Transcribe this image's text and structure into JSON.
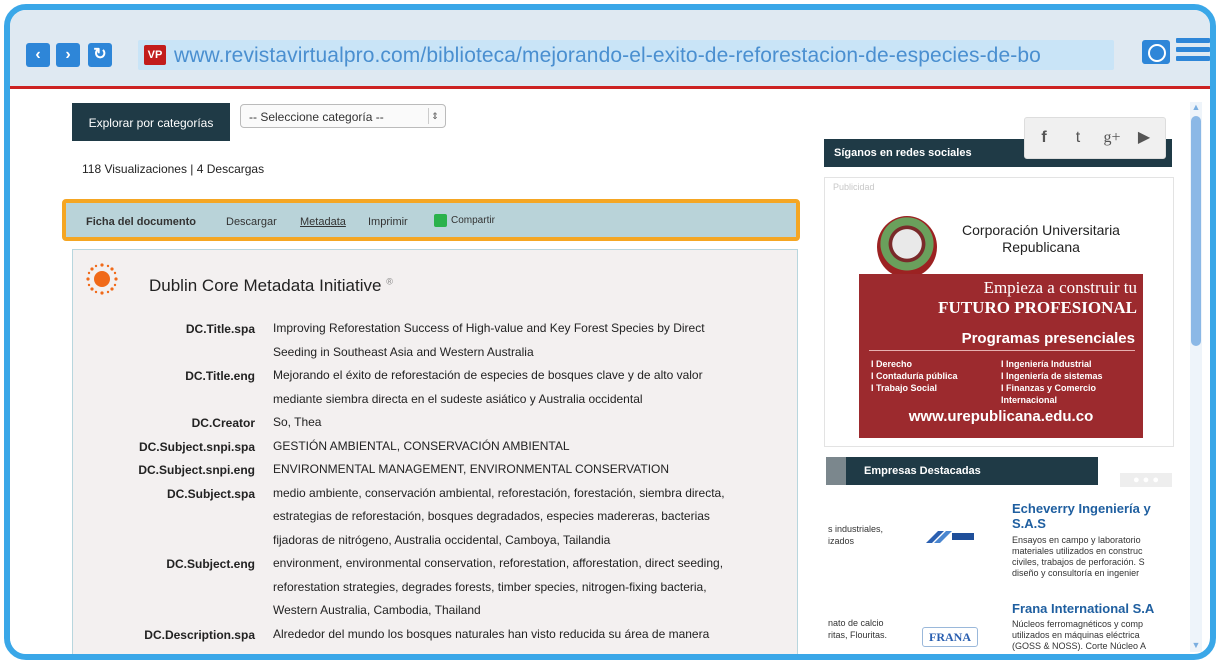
{
  "browser": {
    "url": "www.revistavirtualpro.com/biblioteca/mejorando-el-exito-de-reforestacion-de-especies-de-bo",
    "site_badge": "VP",
    "back_glyph": "‹",
    "forward_glyph": "›",
    "reload_glyph": "↻"
  },
  "category_bar": {
    "explore_label": "Explorar por categorías",
    "select_value": "-- Seleccione categoría --"
  },
  "stats": "118 Visualizaciones | 4 Descargas",
  "doc_tabs": {
    "ficha": "Ficha del documento",
    "descargar": "Descargar",
    "metadata": "Metadata",
    "imprimir": "Imprimir",
    "compartir": "Compartir"
  },
  "dublin_core": {
    "title": "Dublin Core Metadata Initiative",
    "registered": "®",
    "rows": [
      {
        "label": "DC.Title.spa",
        "lines": [
          "Improving Reforestation Success of High-value and Key Forest Species by Direct",
          "Seeding in Southeast Asia and Western Australia"
        ]
      },
      {
        "label": "DC.Title.eng",
        "lines": [
          "Mejorando el éxito de reforestación de especies de bosques clave y de alto valor",
          "mediante siembra directa en el sudeste asiático y Australia occidental"
        ]
      },
      {
        "label": "DC.Creator",
        "lines": [
          "So, Thea"
        ]
      },
      {
        "label": "DC.Subject.snpi.spa",
        "lines": [
          "GESTIÓN AMBIENTAL, CONSERVACIÓN AMBIENTAL"
        ]
      },
      {
        "label": "DC.Subject.snpi.eng",
        "lines": [
          "ENVIRONMENTAL MANAGEMENT, ENVIRONMENTAL CONSERVATION"
        ]
      },
      {
        "label": "DC.Subject.spa",
        "lines": [
          "medio ambiente, conservación ambiental, reforestación, forestación, siembra directa,",
          "estrategias de reforestación, bosques degradados, especies madereras, bacterias",
          "fijadoras de nitrógeno, Australia occidental, Camboya, Tailandia"
        ]
      },
      {
        "label": "DC.Subject.eng",
        "lines": [
          "environment, environmental conservation, reforestation, afforestation, direct seeding,",
          "reforestation strategies, degrades forests, timber species, nitrogen-fixing bacteria,",
          "Western Australia, Cambodia, Thailand"
        ]
      },
      {
        "label": "DC.Description.spa",
        "lines": [
          "Alrededor del mundo los bosques naturales han visto reducida su área de manera"
        ]
      }
    ]
  },
  "sidebar": {
    "social_title": "Síganos en redes sociales",
    "social_icons": [
      "f",
      "t",
      "g+",
      "▶"
    ],
    "ad": {
      "publicidad": "Publicidad",
      "university": "Corporación Universitaria Republicana",
      "headline1": "Empieza a construir tu",
      "headline2": "FUTURO PROFESIONAL",
      "programs_title": "Programas presenciales",
      "programs_left": [
        "I Derecho",
        "I Contaduría pública",
        "I Trabajo Social"
      ],
      "programs_right": [
        "I Ingeniería Industrial",
        "I Ingeniería de sistemas",
        "I Finanzas y Comercio Internacional"
      ],
      "website": "www.urepublicana.edu.co"
    },
    "empresas_title": "Empresas Destacadas",
    "empresas_dots": "● ● ●",
    "companies": [
      {
        "left_text": [
          "s industriales,",
          "izados"
        ],
        "name": "Echeverry Ingeniería y S.A.S",
        "desc": [
          "Ensayos en campo y laboratorio",
          "materiales utilizados en construc",
          "civiles, trabajos de perforación. S",
          "diseño y consultoría en ingenier"
        ]
      },
      {
        "left_text": [
          "nato de calcio",
          "ritas, Flouritas."
        ],
        "name": "Frana International S.A",
        "desc": [
          "Núcleos ferromagnéticos y comp",
          "utilizados en máquinas eléctrica",
          "(GOSS & NOSS). Corte Núcleo A"
        ]
      }
    ],
    "frana_logo_text": "FRANA"
  }
}
